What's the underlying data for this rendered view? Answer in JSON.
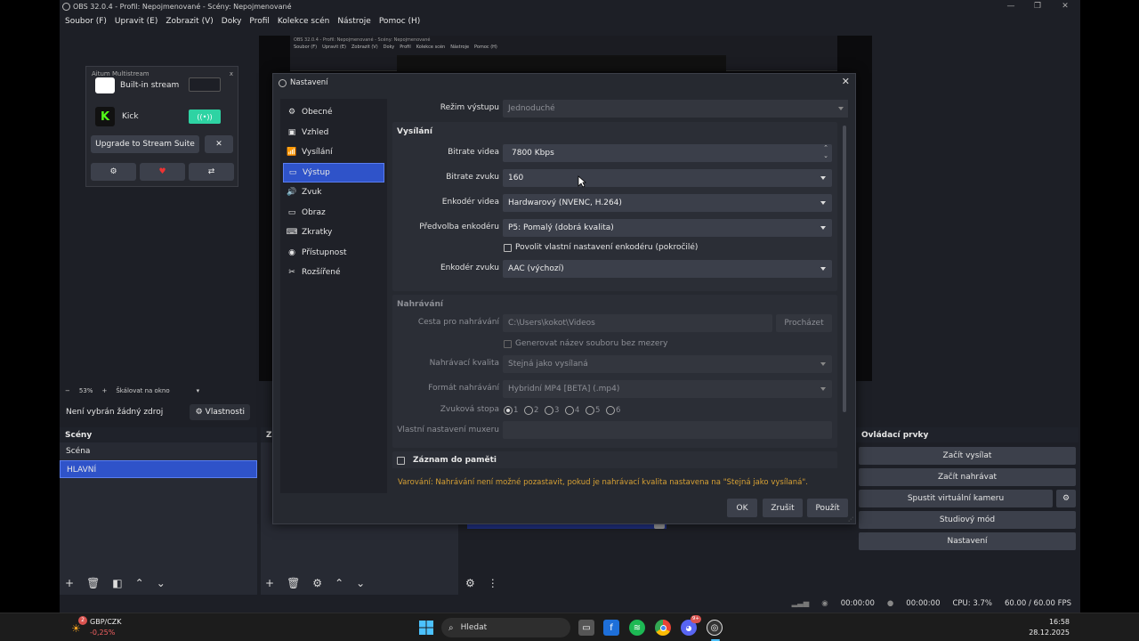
{
  "window": {
    "title": "OBS 32.0.4 - Profil: Nepojmenované - Scény: Nepojmenované",
    "minimize": "—",
    "maximize": "❐",
    "close": "✕"
  },
  "menubar": [
    "Soubor (F)",
    "Upravit (E)",
    "Zobrazit (V)",
    "Doky",
    "Profil",
    "Kolekce scén",
    "Nástroje",
    "Pomoc (H)"
  ],
  "multistream": {
    "title": "Aitum Multistream",
    "close": "x",
    "builtin_label": "Built-in stream",
    "kick_label": "Kick",
    "kick_logo": "K",
    "upgrade_label": "Upgrade to Stream Suite",
    "dismiss": "✕",
    "icons": [
      "gear-icon",
      "heart-icon",
      "share-icon"
    ]
  },
  "zoom": {
    "minus": "−",
    "value": "53%",
    "plus": "+",
    "mode": "Škálovat na okno"
  },
  "sourcebar": {
    "no_source": "Není vybrán žádný zdroj",
    "properties": "Vlastnosti"
  },
  "scenes": {
    "title": "Scény",
    "items": [
      "Scéna",
      "HLAVNÍ"
    ],
    "selected": 1
  },
  "sources_title": "Zd",
  "controls": {
    "title": "Ovládací prvky",
    "buttons": [
      "Začít vysílat",
      "Začít nahrávat",
      "Spustit virtuální kameru",
      "Studiový mód",
      "Nastavení"
    ]
  },
  "status": {
    "stream_time": "00:00:00",
    "rec_time": "00:00:00",
    "cpu": "CPU: 3.7%",
    "fps": "60.00 / 60.00 FPS"
  },
  "dialog": {
    "title": "Nastavení",
    "nav": [
      {
        "label": "Obecné",
        "icon": "gear-icon"
      },
      {
        "label": "Vzhled",
        "icon": "palette-icon"
      },
      {
        "label": "Vysílání",
        "icon": "antenna-icon"
      },
      {
        "label": "Výstup",
        "icon": "output-icon"
      },
      {
        "label": "Zvuk",
        "icon": "speaker-icon"
      },
      {
        "label": "Obraz",
        "icon": "monitor-icon"
      },
      {
        "label": "Zkratky",
        "icon": "keyboard-icon"
      },
      {
        "label": "Přístupnost",
        "icon": "accessibility-icon"
      },
      {
        "label": "Rozšířené",
        "icon": "tools-icon"
      }
    ],
    "selected_nav": 3,
    "output_mode_label": "Režim výstupu",
    "output_mode_value": "Jednoduché",
    "streaming": {
      "title": "Vysílání",
      "video_bitrate_label": "Bitrate videa",
      "video_bitrate_value": "7800 Kbps",
      "audio_bitrate_label": "Bitrate zvuku",
      "audio_bitrate_value": "160",
      "video_encoder_label": "Enkodér videa",
      "video_encoder_value": "Hardwarový (NVENC, H.264)",
      "preset_label": "Předvolba enkodéru",
      "preset_value": "P5: Pomalý (dobrá kvalita)",
      "custom_encoder_label": "Povolit vlastní nastavení enkodéru (pokročilé)",
      "audio_encoder_label": "Enkodér zvuku",
      "audio_encoder_value": "AAC (výchozí)"
    },
    "recording": {
      "title": "Nahrávání",
      "path_label": "Cesta pro nahrávání",
      "path_value": "C:\\Users\\kokot\\Videos",
      "browse_label": "Procházet",
      "no_space_label": "Generovat název souboru bez mezery",
      "quality_label": "Nahrávací kvalita",
      "quality_value": "Stejná jako vysílaná",
      "format_label": "Formát nahrávání",
      "format_value": "Hybridní MP4 [BETA] (.mp4)",
      "track_label": "Zvuková stopa",
      "tracks": [
        "1",
        "2",
        "3",
        "4",
        "5",
        "6"
      ],
      "muxer_label": "Vlastní nastavení muxeru"
    },
    "replay_label": "Záznam do paměti",
    "warning": "Varování: Nahrávání není možné pozastavit, pokud je nahrávací kvalita nastavena na \"Stejná jako vysílaná\".",
    "ok": "OK",
    "cancel": "Zrušit",
    "apply": "Použít"
  },
  "taskbar": {
    "ticker_name": "GBP/CZK",
    "ticker_change": "-0,25%",
    "ticker_badge": "2",
    "search_placeholder": "Hledat",
    "time": "16:58",
    "date": "28.12.2025",
    "discord_badge": "9+"
  }
}
